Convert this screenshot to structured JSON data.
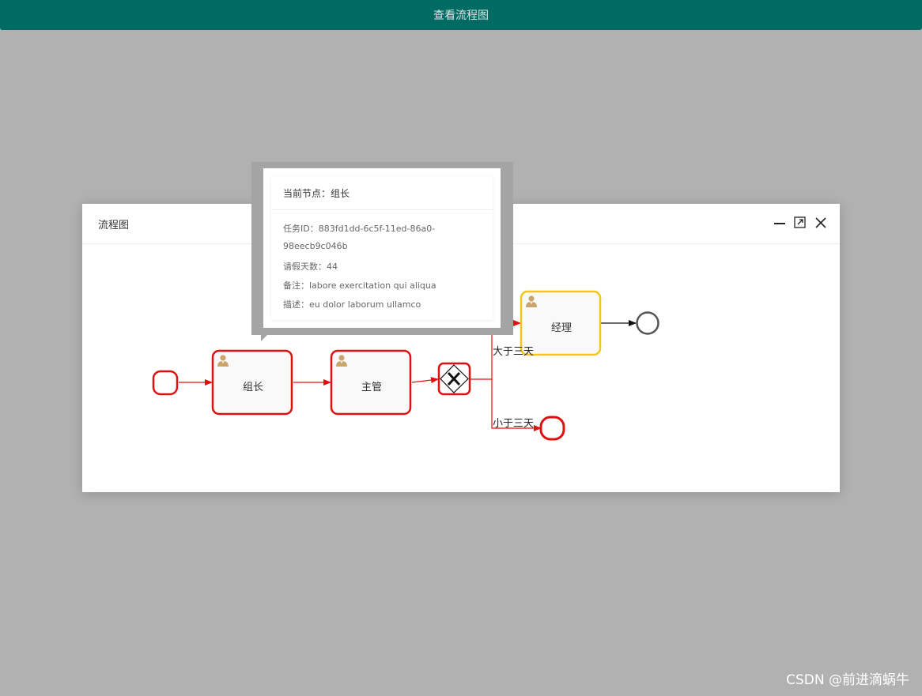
{
  "header": {
    "title": "查看流程图"
  },
  "dialog": {
    "title": "流程图",
    "controls": {
      "minimize_icon": "minimize-icon",
      "maximize_icon": "maximize-icon",
      "close_icon": "close-icon"
    }
  },
  "diagram": {
    "tasks": [
      {
        "id": "zuzhang",
        "label": "组长",
        "status": "completed",
        "border_color": "#e01010"
      },
      {
        "id": "zhuguan",
        "label": "主管",
        "status": "completed",
        "border_color": "#e01010"
      },
      {
        "id": "jingli",
        "label": "经理",
        "status": "current",
        "border_color": "#f5c518"
      }
    ],
    "gateway": {
      "type": "exclusive",
      "icon": "x-icon",
      "border_color": "#e01010"
    },
    "flows": [
      {
        "label": "大于三天"
      },
      {
        "label": "小于三天"
      }
    ],
    "colors": {
      "done": "#e01010",
      "current": "#f5c518",
      "pending": "#555555",
      "user_icon": "#c9a56c"
    }
  },
  "popup": {
    "title": "当前节点：组长",
    "lines": [
      "任务ID：883fd1dd-6c5f-11ed-86a0-",
      "98eecb9c046b",
      "请假天数：44",
      "备注：labore exercitation qui aliqua",
      "描述：eu dolor laborum ullamco"
    ]
  },
  "watermark": "CSDN @前进滴蜗牛"
}
